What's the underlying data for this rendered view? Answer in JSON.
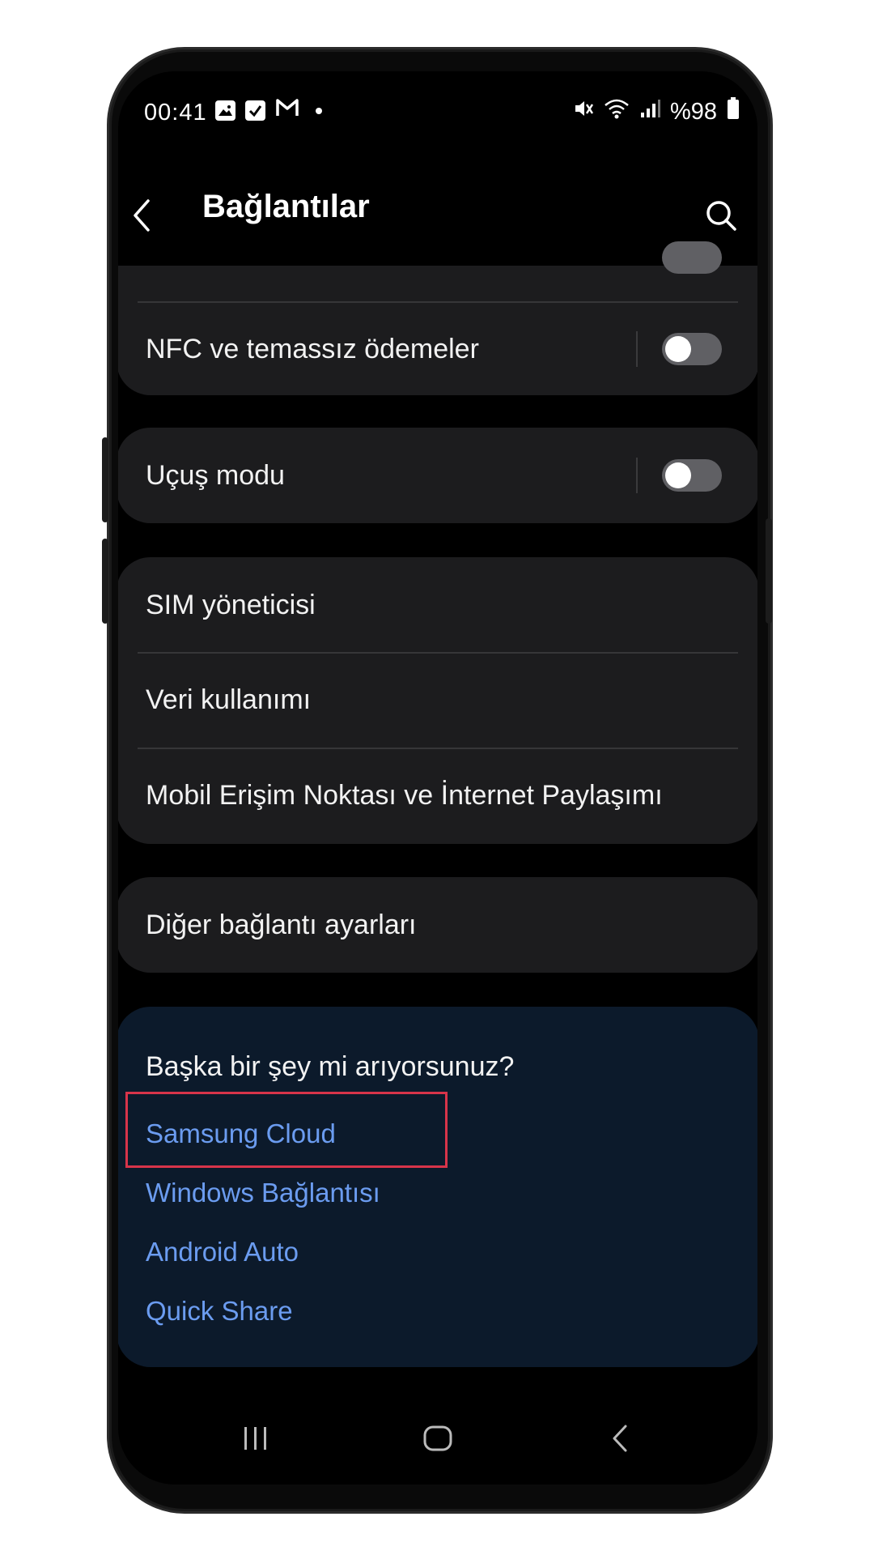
{
  "status_bar": {
    "time": "00:41",
    "battery": "%98"
  },
  "header": {
    "title": "Bağlantılar"
  },
  "settings": {
    "nfc_label": "NFC ve temassız ödemeler",
    "nfc_enabled": false,
    "airplane_label": "Uçuş modu",
    "airplane_enabled": false,
    "sim_label": "SIM yöneticisi",
    "data_usage_label": "Veri kullanımı",
    "hotspot_label": "Mobil Erişim Noktası ve İnternet Paylaşımı",
    "other_label": "Diğer bağlantı ayarları"
  },
  "suggestions": {
    "title": "Başka bir şey mi arıyorsunuz?",
    "links": [
      "Samsung Cloud",
      "Windows Bağlantısı",
      "Android Auto",
      "Quick Share"
    ]
  },
  "colors": {
    "background": "#000000",
    "card": "#1c1c1e",
    "suggest_card": "#0c1a2b",
    "link": "#6b9cf0",
    "highlight": "#d8344a"
  },
  "icons": [
    "back-arrow-icon",
    "search-icon",
    "recents-icon",
    "home-icon",
    "nav-back-icon",
    "gallery-icon",
    "check-icon",
    "gmail-icon",
    "mute-icon",
    "wifi-icon",
    "signal-icon",
    "battery-icon"
  ]
}
